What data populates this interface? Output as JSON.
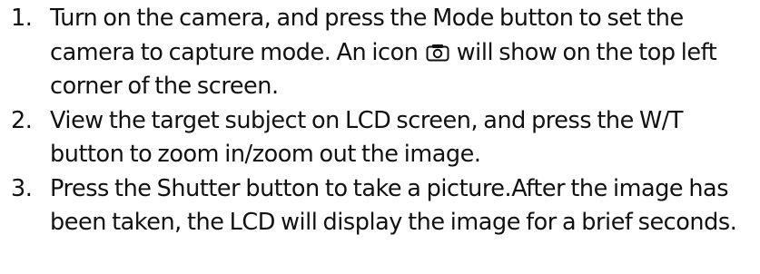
{
  "steps": [
    {
      "number": "1.",
      "text_before_icon": "Turn on the camera, and press the Mode button to set the camera to capture mode. An icon",
      "icon": "camera-icon",
      "text_after_icon": "will show on the top left corner of the screen."
    },
    {
      "number": "2.",
      "text": "View the target subject on LCD screen, and press the W/T button to zoom in/zoom out the image."
    },
    {
      "number": "3.",
      "text": "Press the Shutter button to take a picture.After the image has been taken, the LCD will display the image for a brief seconds."
    }
  ]
}
